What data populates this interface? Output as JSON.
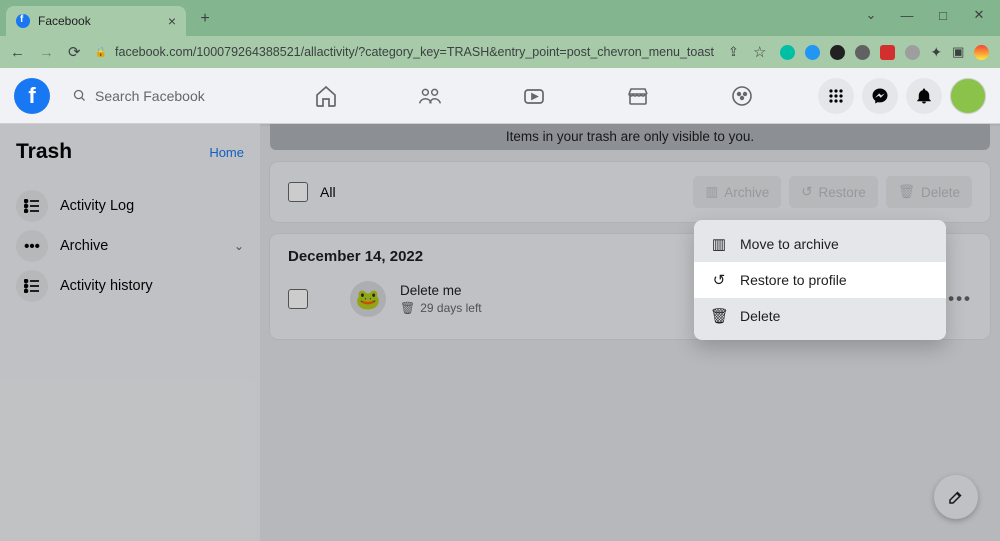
{
  "window": {
    "tab_title": "Facebook",
    "url": "facebook.com/100079264388521/allactivity/?category_key=TRASH&entry_point=post_chevron_menu_toast"
  },
  "fb_header": {
    "search_placeholder": "Search Facebook"
  },
  "sidebar": {
    "title": "Trash",
    "home_link": "Home",
    "items": [
      {
        "label": "Activity Log"
      },
      {
        "label": "Archive"
      },
      {
        "label": "Activity history"
      }
    ]
  },
  "main": {
    "banner": "Items in your trash are only visible to you.",
    "select_all_label": "All",
    "action_buttons": {
      "archive": "Archive",
      "restore": "Restore",
      "delete": "Delete"
    },
    "group_date": "December 14, 2022",
    "post": {
      "title": "Delete me",
      "days_left": "29 days left"
    }
  },
  "context_menu": {
    "move_to_archive": "Move to archive",
    "restore_to_profile": "Restore to profile",
    "delete": "Delete"
  }
}
